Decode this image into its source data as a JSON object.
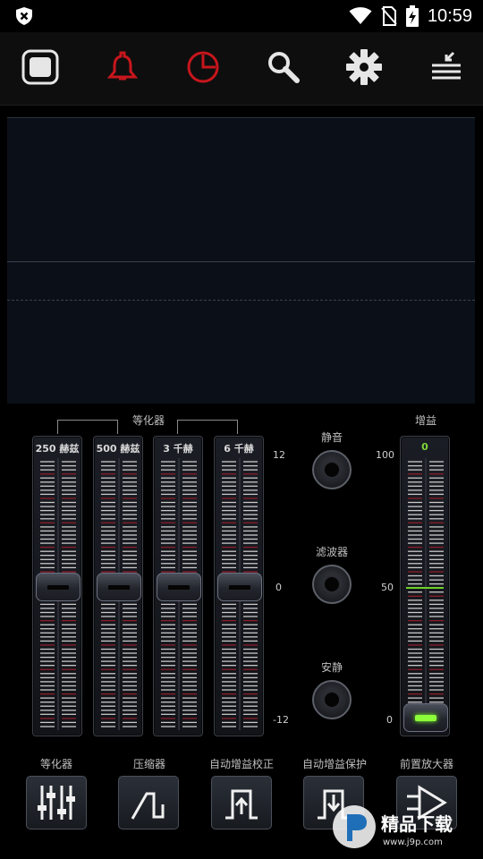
{
  "status_bar": {
    "time": "10:59",
    "icons": [
      "shield-x-icon",
      "wifi-icon",
      "no-sim-icon",
      "battery-charging-icon"
    ]
  },
  "toolbar": {
    "items": [
      {
        "icon": "record-icon",
        "color": "#ffffff"
      },
      {
        "icon": "bell-icon",
        "color": "#c8161d"
      },
      {
        "icon": "timer-icon",
        "color": "#c8161d"
      },
      {
        "icon": "search-icon",
        "color": "#ffffff"
      },
      {
        "icon": "gear-icon",
        "color": "#ffffff"
      },
      {
        "icon": "collapse-menu-icon",
        "color": "#ffffff"
      }
    ]
  },
  "equalizer": {
    "title": "等化器",
    "bands": [
      {
        "label": "250 赫兹",
        "level": 0
      },
      {
        "label": "500 赫兹",
        "level": 0
      },
      {
        "label": "3 千赫",
        "level": 0
      },
      {
        "label": "6 千赫",
        "level": 0
      }
    ],
    "scale": {
      "top": "12",
      "mid": "0",
      "bottom": "-12"
    }
  },
  "toggles": [
    {
      "label": "静音"
    },
    {
      "label": "滤波器"
    },
    {
      "label": "安静"
    }
  ],
  "gain": {
    "title": "增益",
    "value": "0",
    "level": 0,
    "scale": {
      "top": "100",
      "mid": "50",
      "bottom": "0"
    }
  },
  "functions": [
    {
      "label": "等化器",
      "icon": "equalizer-sliders-icon"
    },
    {
      "label": "压缩器",
      "icon": "compressor-curve-icon"
    },
    {
      "label": "自动增益校正",
      "icon": "auto-gain-correction-icon"
    },
    {
      "label": "自动增益保护",
      "icon": "auto-gain-protection-icon"
    },
    {
      "label": "前置放大器",
      "icon": "preamp-icon"
    }
  ],
  "watermark": {
    "text": "精品下载",
    "url_text": "www.j9p.com"
  },
  "colors": {
    "accent_red": "#c8161d",
    "gain_green": "#8dff3a",
    "tick_red": "#8b1f2a"
  }
}
